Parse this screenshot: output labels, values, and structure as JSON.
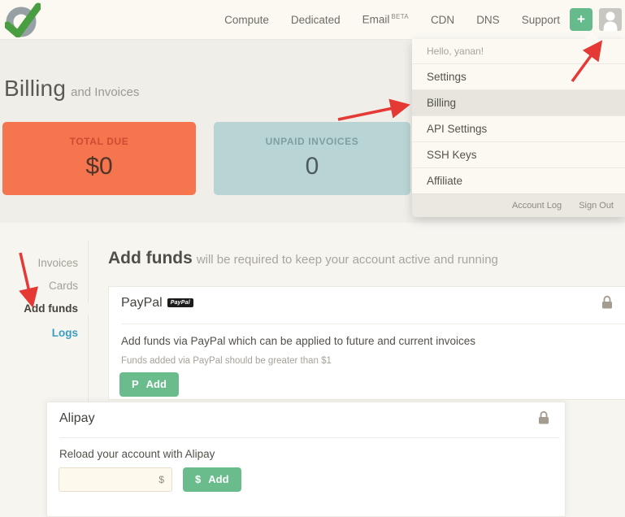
{
  "nav": {
    "items": [
      "Compute",
      "Dedicated",
      "Email",
      "CDN",
      "DNS",
      "Support"
    ],
    "email_beta": "BETA",
    "plus_label": "+"
  },
  "account_menu": {
    "greeting": "Hello, yanan!",
    "items": [
      "Settings",
      "Billing",
      "API Settings",
      "SSH Keys",
      "Affiliate"
    ],
    "active_item": "Billing",
    "footer_links": [
      "Account Log",
      "Sign Out"
    ]
  },
  "billing_header": {
    "title": "Billing",
    "subtitle": "and Invoices"
  },
  "stats": {
    "total_due": {
      "label": "TOTAL DUE",
      "value": "$0"
    },
    "unpaid_invoices": {
      "label": "UNPAID INVOICES",
      "value": "0"
    }
  },
  "sidebar": {
    "items": [
      "Invoices",
      "Cards",
      "Add funds",
      "Logs"
    ],
    "active_item": "Add funds"
  },
  "add_funds": {
    "heading": "Add funds",
    "heading_note": "will be required to keep your account active and running",
    "paypal": {
      "title": "PayPal",
      "badge": "PayPal",
      "description": "Add funds via PayPal which can be applied to future and current invoices",
      "note": "Funds added via PayPal should be greater than $1",
      "button_icon": "P",
      "button_label": "Add"
    },
    "alipay": {
      "title": "Alipay",
      "description": "Reload your account with Alipay",
      "amount_value": "",
      "amount_suffix": "$",
      "button_icon": "$",
      "button_label": "Add"
    }
  },
  "colors": {
    "accent_green": "#66bb8c",
    "card_orange": "#f5764e",
    "card_teal": "#b9d4d4",
    "link_blue": "#3b9dc4",
    "annotation_red": "#e53935"
  }
}
